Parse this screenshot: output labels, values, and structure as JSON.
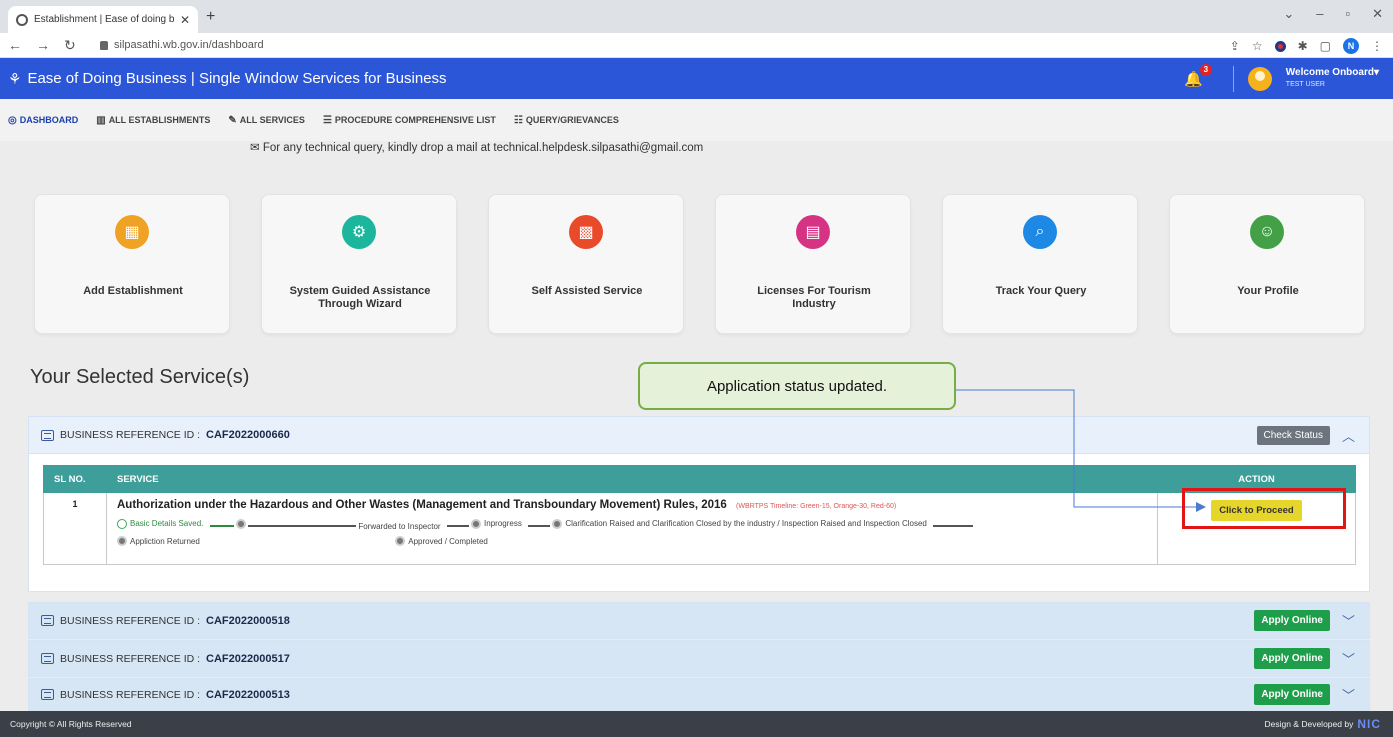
{
  "browser": {
    "tab_title": "Establishment | Ease of doing bu",
    "new_tab": "+",
    "url": "silpasathi.wb.gov.in/dashboard",
    "profile_initial": "N"
  },
  "header": {
    "brand": "Ease of Doing Business | Single Window Services for Business",
    "notification_count": "3",
    "welcome": "Welcome Onboard",
    "user": "TEST USER"
  },
  "menu": [
    {
      "label": "DASHBOARD",
      "icon": "dashboard-icon"
    },
    {
      "label": "ALL ESTABLISHMENTS",
      "icon": "building-icon"
    },
    {
      "label": "ALL SERVICES",
      "icon": "wrench-icon"
    },
    {
      "label": "PROCEDURE COMPREHENSIVE LIST",
      "icon": "list-icon"
    },
    {
      "label": "QUERY/GRIEVANCES",
      "icon": "message-icon"
    }
  ],
  "helpline": "For any technical query, kindly drop a mail at technical.helpdesk.silpasathi@gmail.com",
  "cards": [
    {
      "label": "Add Establishment",
      "icon": "building-add-icon",
      "color": "#f0a225"
    },
    {
      "label": "System Guided Assistance Through Wizard",
      "icon": "gear-icon",
      "color": "#1bb69b"
    },
    {
      "label": "Self Assisted Service",
      "icon": "grid-icon",
      "color": "#e84a2a"
    },
    {
      "label": "Licenses For Tourism Industry",
      "icon": "license-icon",
      "color": "#d63384"
    },
    {
      "label": "Track Your Query",
      "icon": "search-icon",
      "color": "#1e88e5"
    },
    {
      "label": "Your Profile",
      "icon": "profile-icon",
      "color": "#43a047"
    }
  ],
  "selected_title": "Your Selected Service(s)",
  "ref_prefix": "BUSINESS REFERENCE ID :",
  "active_ref": {
    "id": "CAF2022000660",
    "check_status": "Check Status"
  },
  "table": {
    "col_sl": "SL NO.",
    "col_service": "SERVICE",
    "col_action": "ACTION",
    "row": {
      "sl": "1",
      "service": "Authorization under the Hazardous and Other Wastes (Management and Transboundary Movement) Rules, 2016",
      "timeline": "(WBRTPS Timeline: Green-15, Orange-30, Red-60)",
      "steps": {
        "s1": "Basic Details Saved.",
        "s2": "Forwarded to Inspector",
        "s3": "Inprogress",
        "s4": "Clarification Raised and Clarification Closed by the industry / Inspection Raised and Inspection Closed",
        "s5": "Appliction Returned",
        "s6": "Approved / Completed"
      },
      "action": "Click to Proceed"
    }
  },
  "other_refs": [
    {
      "id": "CAF2022000518",
      "button": "Apply Online"
    },
    {
      "id": "CAF2022000517",
      "button": "Apply Online"
    },
    {
      "id": "CAF2022000513",
      "button": "Apply Online"
    }
  ],
  "callout": "Application status updated.",
  "footer": {
    "copyright": "Copyright © All Rights Reserved",
    "credit": "Design & Developed by",
    "logo": "NIC"
  }
}
